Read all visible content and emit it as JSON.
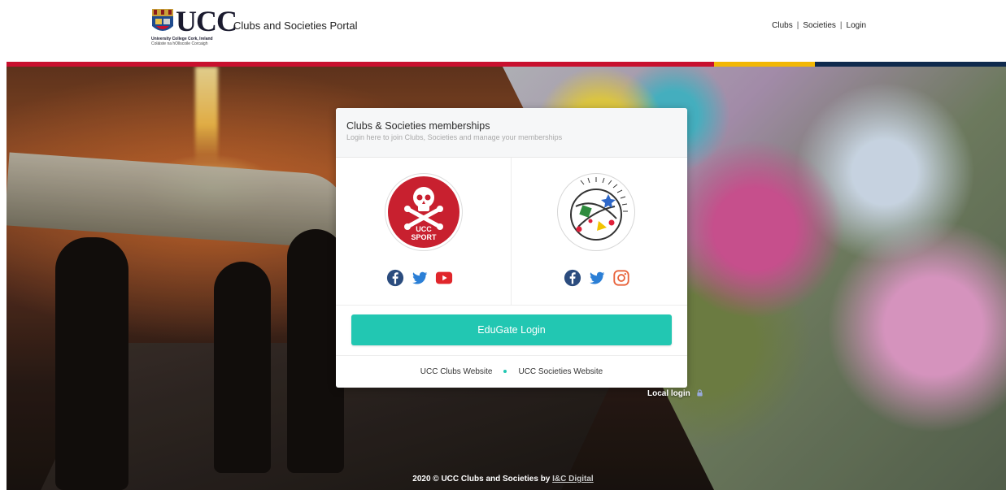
{
  "header": {
    "logo_text": "UCC",
    "logo_sub1": "University College Cork, Ireland",
    "logo_sub2": "Coláiste na hOllscoile Corcaigh",
    "portal_title": "Clubs and Societies Portal",
    "nav": {
      "clubs": "Clubs",
      "separator": "|",
      "societies": "Societies",
      "login": "Login"
    }
  },
  "stripe_colors": {
    "red": "#c8102e",
    "yellow": "#f2b705",
    "navy": "#0f2a4d"
  },
  "card": {
    "title": "Clubs & Societies memberships",
    "subtitle": "Login here to join Clubs, Societies and manage your memberships",
    "left": {
      "badge_line1": "UCC",
      "badge_line2": "SPORT",
      "icons": [
        "facebook-icon",
        "twitter-icon",
        "youtube-icon"
      ]
    },
    "right": {
      "icons": [
        "facebook-icon",
        "twitter-icon",
        "instagram-icon"
      ]
    },
    "edugate_label": "EduGate Login",
    "footer": {
      "clubs_link": "UCC Clubs Website",
      "societies_link": "UCC Societies Website"
    }
  },
  "accent_color": "#22c7b2",
  "local_login": "Local login",
  "footer": {
    "text": "2020 © UCC Clubs and Societies by ",
    "link": "I&C Digital"
  }
}
